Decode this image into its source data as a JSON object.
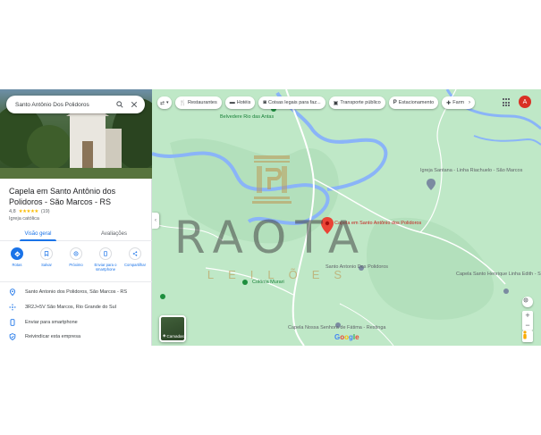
{
  "search": {
    "value": "Santo Antônio Dos Polidoros",
    "search_icon": "search-icon",
    "close_icon": "close-icon"
  },
  "place": {
    "title": "Capela em Santo Antônio dos Polidoros - São Marcos - RS",
    "rating": "4,8",
    "stars": "★★★★★",
    "reviews": "(19)",
    "category": "Igreja católica"
  },
  "tabs": [
    {
      "label": "Visão geral",
      "active": true
    },
    {
      "label": "Avaliações",
      "active": false
    }
  ],
  "actions": [
    {
      "label": "Rotas",
      "icon": "directions-icon"
    },
    {
      "label": "Salvar",
      "icon": "bookmark-icon"
    },
    {
      "label": "Próximo",
      "icon": "nearby-icon"
    },
    {
      "label": "Enviar para o smartphone",
      "icon": "phone-icon"
    },
    {
      "label": "Compartilhar",
      "icon": "share-icon"
    }
  ],
  "info": [
    {
      "text": "Santo Antonio dos Polidoros, São Marcos - RS",
      "icon": "location-pin-icon"
    },
    {
      "text": "3R2J+5V São Marcos, Rio Grande do Sul",
      "icon": "plus-code-icon"
    },
    {
      "text": "Enviar para smartphone",
      "icon": "phone-icon"
    },
    {
      "text": "Reivindicar esta empresa",
      "icon": "shield-icon"
    }
  ],
  "map": {
    "chips": [
      {
        "label": "Restaurantes",
        "icon": "fork-knife-icon"
      },
      {
        "label": "Hotéis",
        "icon": "bed-icon"
      },
      {
        "label": "Coisas legais para faz...",
        "icon": "camera-icon"
      },
      {
        "label": "Transporte público",
        "icon": "transit-icon"
      },
      {
        "label": "Estacionamento",
        "icon": "parking-icon"
      },
      {
        "label": "Farm",
        "icon": "pharmacy-icon"
      }
    ],
    "labels": {
      "belvedere": "Belvedere Rio das Antas",
      "igreja_santana": "Igreja Santana - Linha Riachuelo - São Marcos",
      "capela_pin": "Capela em Santo Antônio dos Polidoros",
      "santo_antonio": "Santo Antonio Dos Polidoros",
      "colonia": "Colônia Murari",
      "capela_henrique": "Capela Santo Henrique Linha Edith - São",
      "nossa_senhora": "Capela Nossa Senhora de Fátima - Restinga"
    },
    "layers_label": "Camadas",
    "google": "Google",
    "avatar_letter": "A",
    "colors": {
      "water": "#8ab4f8",
      "land": "#b9e6c2",
      "pin": "#ea4335"
    }
  },
  "watermark": {
    "brand": "RAOTA",
    "sub": "LEILÕES"
  }
}
